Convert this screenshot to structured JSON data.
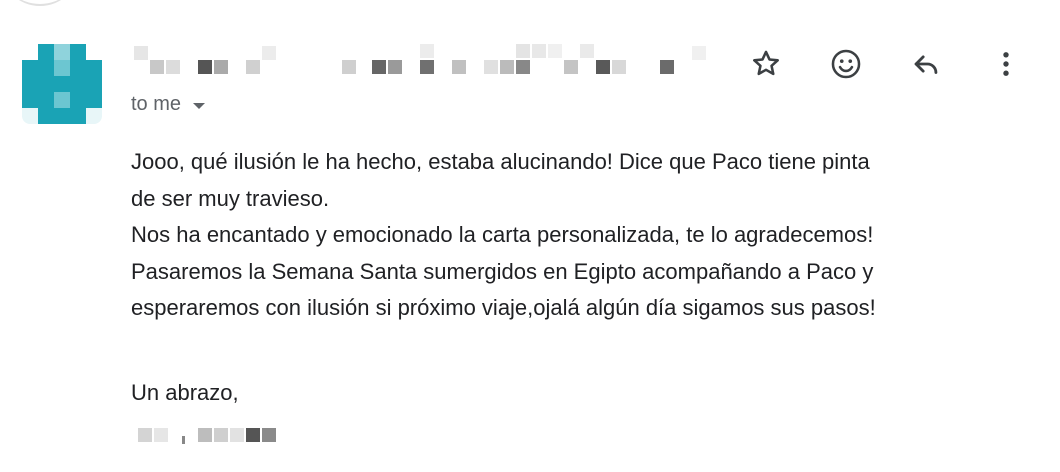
{
  "email": {
    "recipient_label": "to me",
    "body_lines": [
      "Jooo, qué ilusión le ha hecho, estaba alucinando! Dice que Paco tiene pinta",
      "de ser muy travieso.",
      "Nos ha encantado y emocionado la carta personalizada, te lo agradecemos!",
      "Pasaremos la Semana Santa sumergidos en Egipto acompañando a Paco y",
      "esperaremos con ilusión si próximo viaje,ojalá algún día sigamos sus pasos!"
    ],
    "signoff": "Un abrazo,"
  },
  "icons": {
    "star": "star-icon",
    "emoji": "emoji-icon",
    "reply": "reply-icon",
    "more": "more-vertical-icon",
    "caret": "caret-down-icon"
  },
  "colors": {
    "text": "#202124",
    "secondary_text": "#5f6368",
    "avatar_teal": "#1aa3b5",
    "icon": "#3c4043"
  }
}
